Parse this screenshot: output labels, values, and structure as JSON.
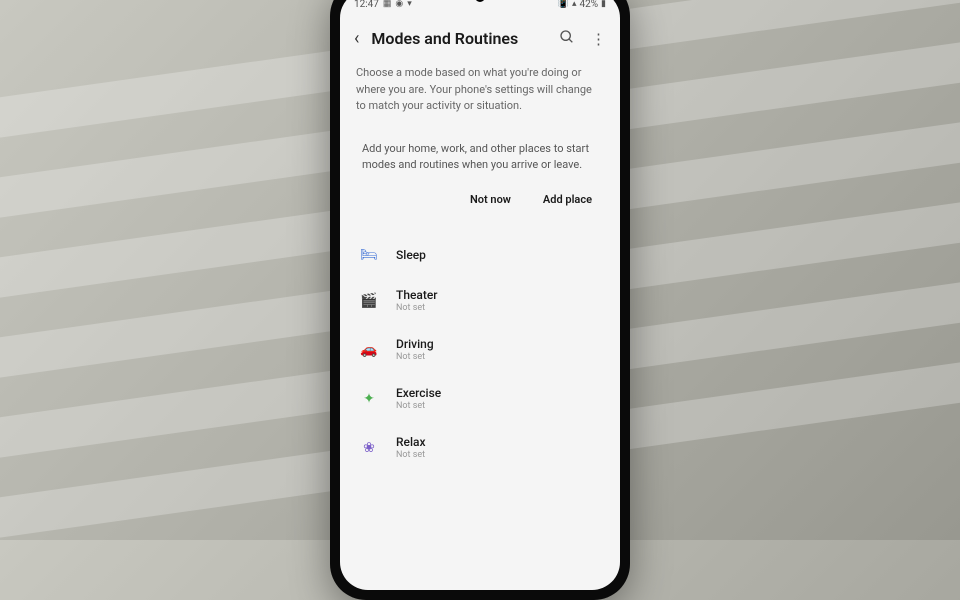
{
  "status": {
    "time": "12:47",
    "battery": "42%"
  },
  "header": {
    "title": "Modes and Routines"
  },
  "description": "Choose a mode based on what you're doing or where you are. Your phone's settings will change to match your activity or situation.",
  "prompt": {
    "text": "Add your home, work, and other places to start modes and routines when you arrive or leave.",
    "notNow": "Not now",
    "addPlace": "Add place"
  },
  "modes": [
    {
      "icon": "🛏",
      "label": "Sleep",
      "sub": "",
      "iconClass": "icon-sleep"
    },
    {
      "icon": "🎬",
      "label": "Theater",
      "sub": "Not set",
      "iconClass": "icon-theater"
    },
    {
      "icon": "🚗",
      "label": "Driving",
      "sub": "Not set",
      "iconClass": "icon-driving"
    },
    {
      "icon": "✦",
      "label": "Exercise",
      "sub": "Not set",
      "iconClass": "icon-exercise"
    },
    {
      "icon": "❀",
      "label": "Relax",
      "sub": "Not set",
      "iconClass": "icon-relax"
    }
  ]
}
